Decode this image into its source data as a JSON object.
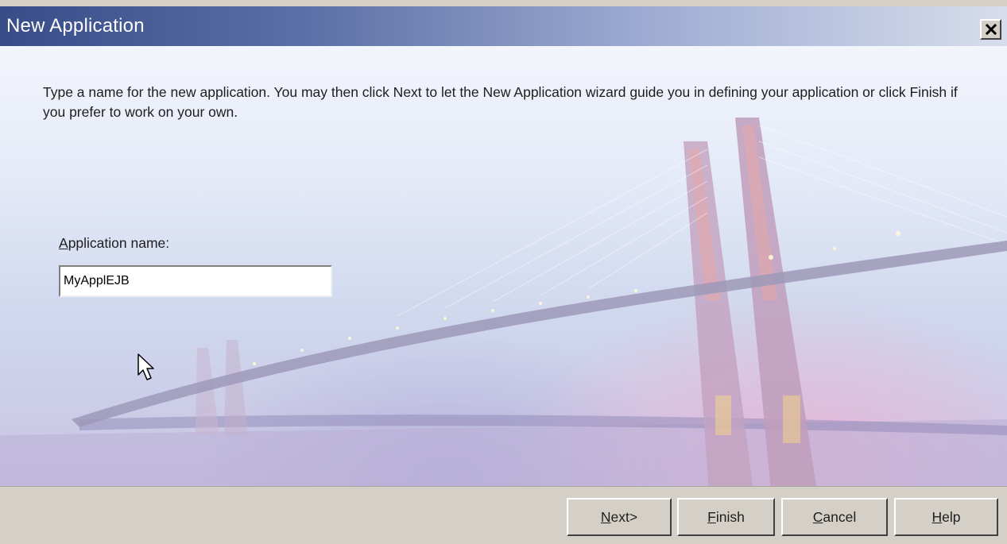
{
  "window": {
    "title": "New Application",
    "close_symbol": "✕"
  },
  "main": {
    "instructions": "Type a name for the new application. You may then click Next to let the New Application wizard guide you in defining your application or click Finish if you prefer to work on your own.",
    "field_label_mnemonic": "A",
    "field_label_rest": "pplication name:",
    "app_name_value": "MyApplEJB",
    "background_image": "bridge-at-dusk"
  },
  "buttons": {
    "next": {
      "mnemonic": "N",
      "rest": "ext>"
    },
    "finish": {
      "mnemonic": "F",
      "rest": "inish"
    },
    "cancel": {
      "mnemonic": "C",
      "rest": "ancel"
    },
    "help": {
      "mnemonic": "H",
      "rest": "elp"
    }
  },
  "colors": {
    "titlebar_start": "#384c88",
    "titlebar_end": "#d7ddec",
    "dialog_face": "#d4d0c8"
  }
}
